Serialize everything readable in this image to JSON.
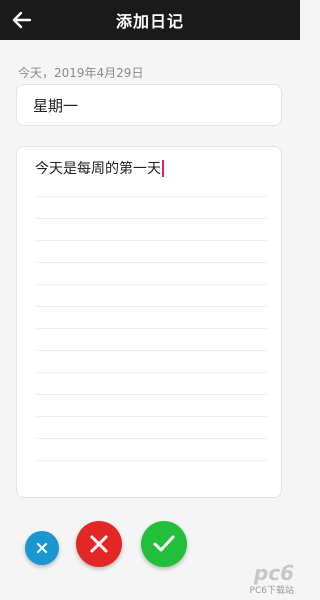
{
  "header": {
    "title": "添加日记",
    "back_icon": "arrow-left-icon",
    "background": "#1a1a1a"
  },
  "date_line": "今天，2019年4月29日",
  "diary": {
    "title_value": "星期一",
    "body_value": "今天是每周的第一天"
  },
  "actions": {
    "small_icon": "close-icon",
    "cancel_icon": "close-icon",
    "confirm_icon": "check-icon",
    "colors": {
      "small": "#1a96d0",
      "cancel": "#e32626",
      "confirm": "#22c03a"
    }
  },
  "watermark": {
    "logo": "pc6",
    "text": "PC6下载站"
  }
}
